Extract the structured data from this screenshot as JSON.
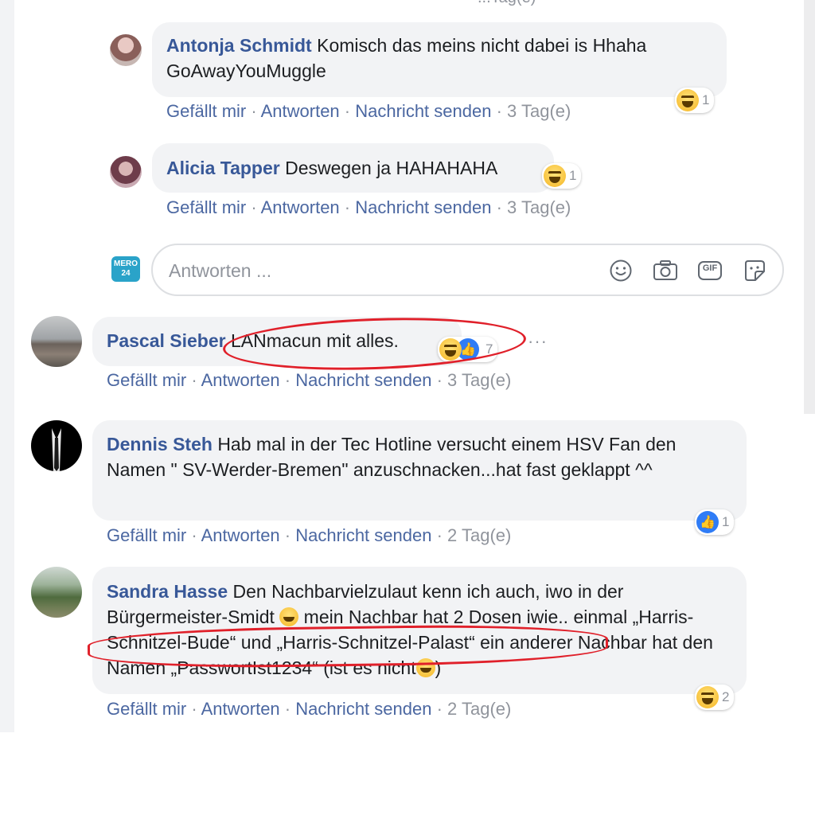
{
  "top_cropped_text": "...Tag(e)",
  "actions": {
    "like": "Gefällt mir",
    "reply": "Antworten",
    "message": "Nachricht senden",
    "sep": "·"
  },
  "replies": [
    {
      "name": "Antonja Schmidt",
      "text": "Komisch das meins nicht dabei is Hhaha GoAwayYouMuggle",
      "time": "3 Tag(e)",
      "reaction_count": "1"
    },
    {
      "name": "Alicia Tapper",
      "text": "Deswegen ja HAHAHAHA",
      "time": "3 Tag(e)",
      "reaction_count": "1"
    }
  ],
  "reply_box": {
    "placeholder": "Antworten ...",
    "avatar_text": "MERO 24",
    "icons": [
      "smiley-icon",
      "camera-icon",
      "gif-icon",
      "sticker-icon"
    ],
    "gif_label": "GIF"
  },
  "comments": [
    {
      "name": "Pascal Sieber",
      "text": "LANmacun mit alles.",
      "time": "3 Tag(e)",
      "reaction_count": "7",
      "more": "···"
    },
    {
      "name": "Dennis Steh",
      "text": "Hab mal in der Tec Hotline versucht einem HSV Fan den Namen \" SV-Werder-Bremen\" anzuschnacken...hat fast geklappt ^^",
      "time": "2 Tag(e)",
      "reaction_count": "1"
    },
    {
      "name": "Sandra Hasse",
      "text_part1": "Den Nachbarvielzulaut kenn ich auch, iwo in der Bürgermeister-Smidt ",
      "text_part2": " mein Nachbar hat 2 Dosen iwie.. einmal „Harris-Schnitzel-Bude“ und „Harris-Schnitzel-Palast“ ein anderer Nachbar hat den Namen „PasswortIst1234“ (ist es nicht",
      "text_part3": ")",
      "time": "2 Tag(e)",
      "reaction_count": "2"
    }
  ],
  "colors": {
    "name_link": "#385898",
    "bubble_bg": "#f2f3f5",
    "meta_text": "#90949c",
    "annotation_red": "#e0202a"
  }
}
